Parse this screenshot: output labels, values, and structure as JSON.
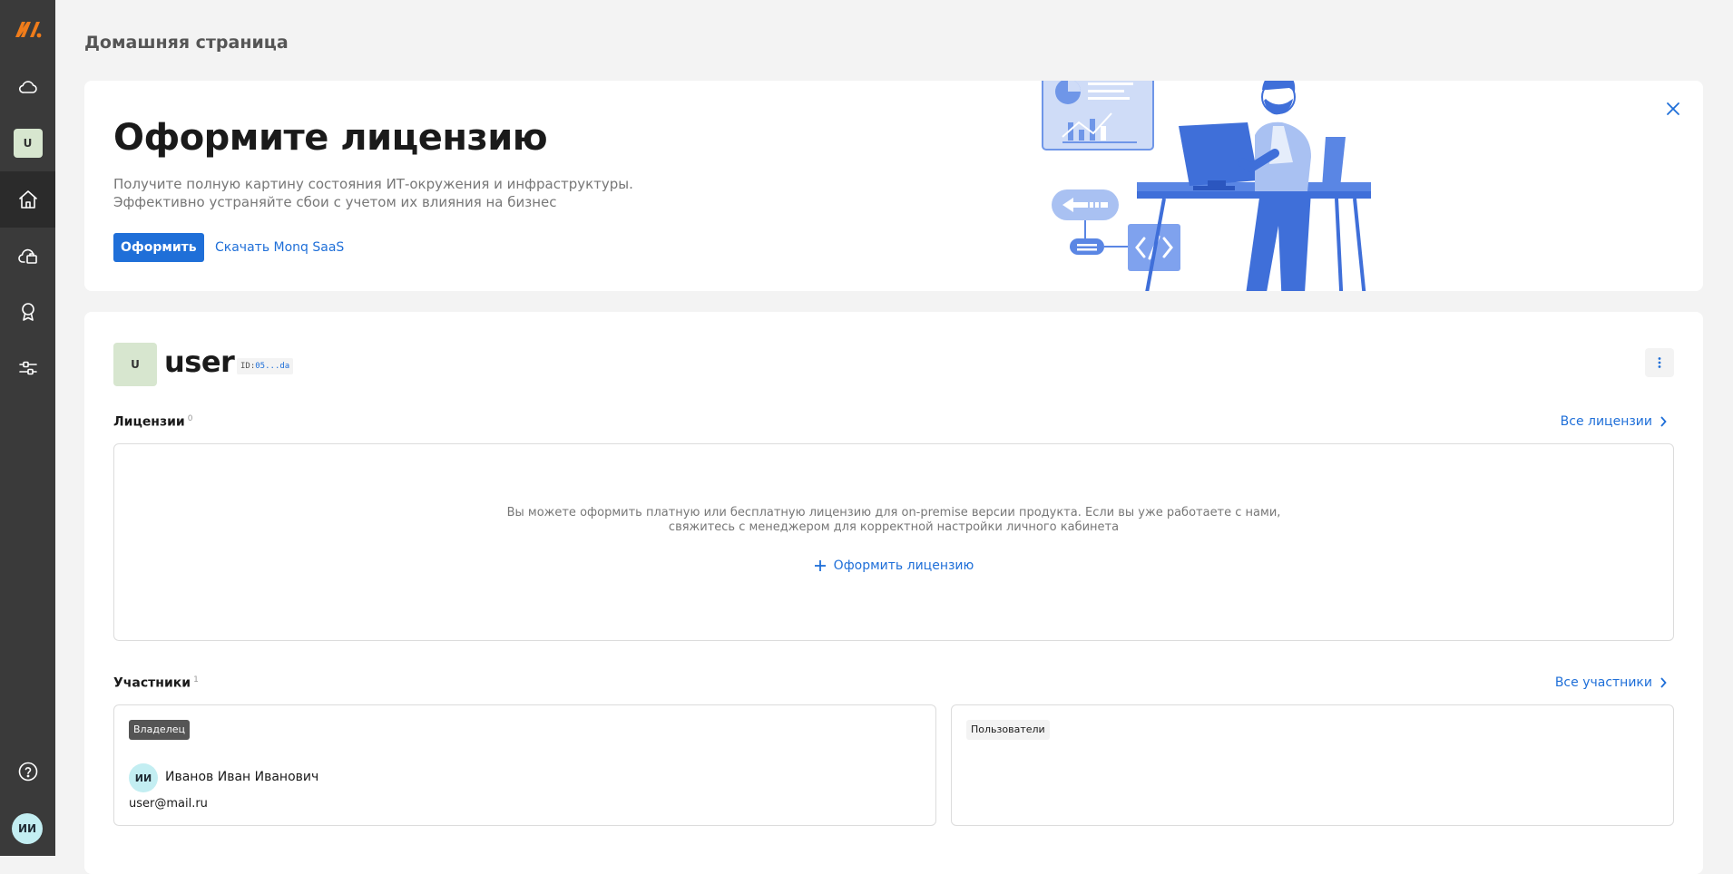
{
  "sidebar": {
    "logo_icon": "monq-logo-icon",
    "workspace_initials": "U",
    "user_initials": "ИИ",
    "items": [
      {
        "icon": "cloud-icon"
      },
      {
        "icon": "home-icon"
      },
      {
        "icon": "cloud-briefcase-icon"
      },
      {
        "icon": "award-icon"
      },
      {
        "icon": "sliders-icon"
      }
    ],
    "help_icon": "help-icon"
  },
  "page": {
    "title": "Домашняя страница"
  },
  "banner": {
    "title": "Оформите лицензию",
    "description_line1": "Получите полную картину состояния ИТ-окружения и инфраструктуры.",
    "description_line2": "Эффективно устраняйте сбои с учетом их влияния на бизнес",
    "primary_button": "Оформить",
    "download_link": "Скачать Monq SaaS"
  },
  "org": {
    "initials": "U",
    "name": "user",
    "id_label": "ID:",
    "id_value": "05...da"
  },
  "licenses": {
    "title": "Лицензии",
    "count": "0",
    "all_link": "Все лицензии",
    "empty_line1": "Вы можете оформить платную или бесплатную лицензию для on-premise версии продукта. Если вы уже работаете с нами,",
    "empty_line2": "свяжитесь с менеджером для корректной настройки личного кабинета",
    "add_link": "Оформить лицензию"
  },
  "members": {
    "title": "Участники",
    "count": "1",
    "all_link": "Все участники",
    "owner_badge": "Владелец",
    "owner_initials": "ИИ",
    "owner_name": "Иванов Иван Иванович",
    "owner_email": "user@mail.ru",
    "users_badge": "Пользователи"
  },
  "colors": {
    "accent": "#1f6fd8",
    "sidebar": "#3a3a3a",
    "logo_orange": "#f07c1a"
  }
}
